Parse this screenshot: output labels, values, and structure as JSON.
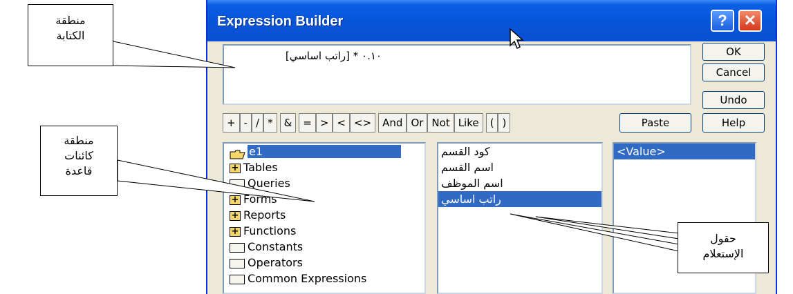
{
  "dialog": {
    "title": "Expression Builder",
    "help_glyph": "?",
    "close_glyph": "✕",
    "expression": "[راتب اساسي] * ۰.۱۰"
  },
  "buttons": {
    "ok": "OK",
    "cancel": "Cancel",
    "undo": "Undo",
    "paste": "Paste",
    "help": "Help"
  },
  "operators": [
    "+",
    "-",
    "/",
    "*",
    "&",
    "=",
    ">",
    "<",
    "<>",
    "And",
    "Or",
    "Not",
    "Like",
    "(",
    ")"
  ],
  "tree": [
    {
      "label": "e1",
      "icon": "open-folder-icon",
      "selected": true
    },
    {
      "label": "Tables",
      "icon": "expand-folder-icon"
    },
    {
      "label": "Queries",
      "icon": "folder-icon"
    },
    {
      "label": "Forms",
      "icon": "expand-folder-icon"
    },
    {
      "label": "Reports",
      "icon": "expand-folder-icon"
    },
    {
      "label": "Functions",
      "icon": "expand-folder-icon"
    },
    {
      "label": "Constants",
      "icon": "folder-icon"
    },
    {
      "label": "Operators",
      "icon": "folder-icon"
    },
    {
      "label": "Common Expressions",
      "icon": "folder-icon"
    }
  ],
  "fields": [
    {
      "label": "كود القسم"
    },
    {
      "label": "اسم القسم"
    },
    {
      "label": "اسم الموظف"
    },
    {
      "label": "راتب اساسي",
      "selected": true
    }
  ],
  "values": [
    {
      "label": "<Value>",
      "selected": true
    }
  ],
  "callouts": {
    "writing_area": "منطقة\nالكتابة",
    "objects_area": "منطقة\nكائنات\nقاعدة",
    "query_fields": "حقول\nالإستعلام"
  },
  "colors": {
    "titlebar": "#0754d8",
    "selection": "#316ac5",
    "dialog_bg": "#ece9d8"
  }
}
